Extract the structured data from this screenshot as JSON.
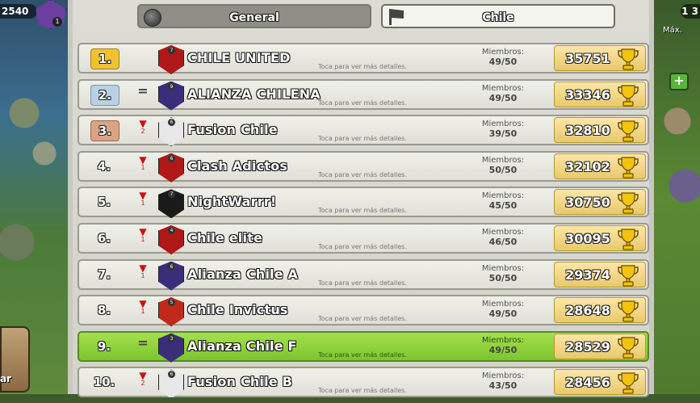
{
  "hud": {
    "left_score": "2540",
    "left_badge_num": "1",
    "left_button_label": "ar",
    "right_top": "1 3",
    "right_max": "Máx.",
    "right_plus": "+"
  },
  "tabs": [
    {
      "label": "General",
      "icon": "globe-icon",
      "active": false
    },
    {
      "label": "Chile",
      "icon": "flag-icon",
      "active": true
    }
  ],
  "members_label": "Miembros:",
  "detail_text": "Toca para ver más detalles.",
  "clans": [
    {
      "rank": "1.",
      "rank_style": "gold",
      "change": "",
      "change_count": "",
      "badge_color": "#b01818",
      "badge_level": "7",
      "name": "CHILE UNITED",
      "members": "49/50",
      "trophies": "35751",
      "highlight": false
    },
    {
      "rank": "2.",
      "rank_style": "silver",
      "change": "=",
      "change_count": "",
      "badge_color": "#3a2e7a",
      "badge_level": "9",
      "name": "ALIANZA CHILENA",
      "members": "49/50",
      "trophies": "33346",
      "highlight": false
    },
    {
      "rank": "3.",
      "rank_style": "bronze",
      "change": "▼",
      "change_count": "2",
      "badge_color": "#e8e8e8",
      "badge_level": "6",
      "name": "Fusion Chile",
      "members": "39/50",
      "trophies": "32810",
      "highlight": false
    },
    {
      "rank": "4.",
      "rank_style": "",
      "change": "▼",
      "change_count": "1",
      "badge_color": "#b01818",
      "badge_level": "6",
      "name": "Clash Adictos",
      "members": "50/50",
      "trophies": "32102",
      "highlight": false
    },
    {
      "rank": "5.",
      "rank_style": "",
      "change": "▼",
      "change_count": "1",
      "badge_color": "#1a1a1a",
      "badge_level": "7",
      "name": "NightWarrr!",
      "members": "45/50",
      "trophies": "30750",
      "highlight": false
    },
    {
      "rank": "6.",
      "rank_style": "",
      "change": "▼",
      "change_count": "1",
      "badge_color": "#b01818",
      "badge_level": "4",
      "name": "Chile elite",
      "members": "46/50",
      "trophies": "30095",
      "highlight": false
    },
    {
      "rank": "7.",
      "rank_style": "",
      "change": "▼",
      "change_count": "1",
      "badge_color": "#3a2e7a",
      "badge_level": "6",
      "name": "Alianza Chile A",
      "members": "50/50",
      "trophies": "29374",
      "highlight": false
    },
    {
      "rank": "8.",
      "rank_style": "",
      "change": "▼",
      "change_count": "1",
      "badge_color": "#c0281a",
      "badge_level": "5",
      "name": "Chile Invictus",
      "members": "49/50",
      "trophies": "28648",
      "highlight": false
    },
    {
      "rank": "9.",
      "rank_style": "",
      "change": "=",
      "change_count": "",
      "badge_color": "#3a2e7a",
      "badge_level": "3",
      "name": "Alianza Chile F",
      "members": "49/50",
      "trophies": "28529",
      "highlight": true
    },
    {
      "rank": "10.",
      "rank_style": "",
      "change": "▼",
      "change_count": "2",
      "badge_color": "#e8e8e8",
      "badge_level": "6",
      "name": "Fusion Chile B",
      "members": "43/50",
      "trophies": "28456",
      "highlight": false
    }
  ]
}
